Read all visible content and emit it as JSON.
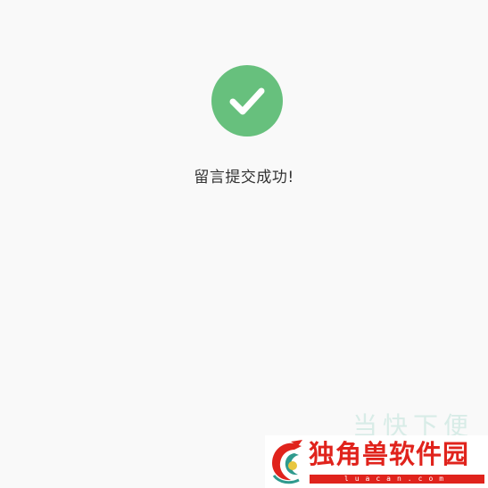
{
  "message": {
    "text": "留言提交成功!"
  },
  "icon": {
    "name": "check-circle-icon",
    "color": "#67c07d"
  },
  "background_color": "#f9f9f9",
  "watermark": {
    "faint_text": "当快下便",
    "title": "独角兽软件园",
    "domain": "luacan.com",
    "accent_color": "#e0231c"
  }
}
